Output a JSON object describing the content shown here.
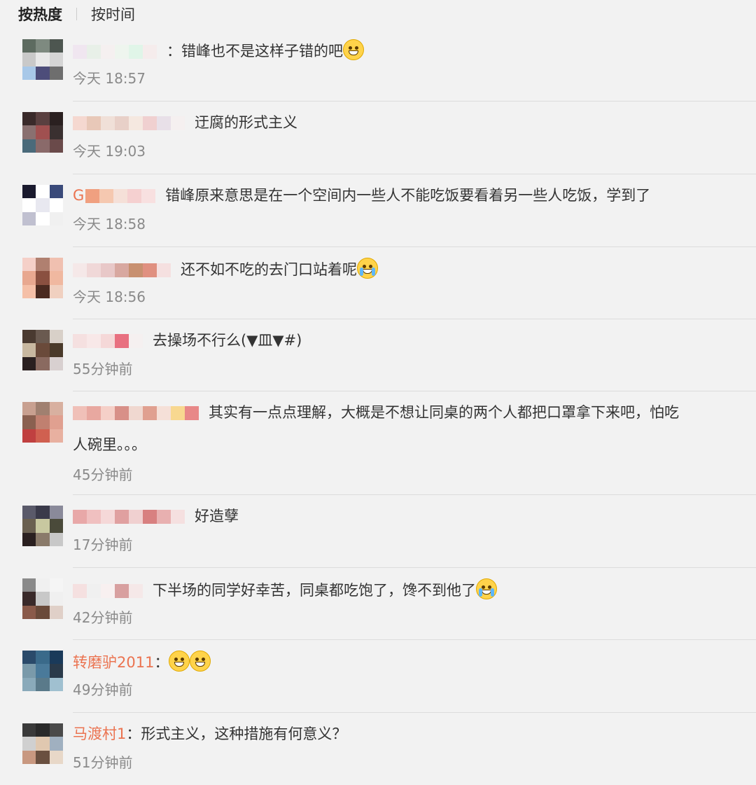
{
  "tabs": {
    "hot": "按热度",
    "time": "按时间"
  },
  "comments": [
    {
      "name": "",
      "text": "：错峰也不是这样子错的吧",
      "time": "今天 18:57",
      "emoji": "sweat-smile-emoji",
      "avatar": [
        "#5d6b60",
        "#7e8a80",
        "#4d5650",
        "#c9c9c9",
        "#e8e8e8",
        "#d5d5d5",
        "#a8c8e8",
        "#4d4d7a",
        "#6e6e6e"
      ],
      "blur": [
        "#f0e6f0",
        "#e8f0e8",
        "#f5f0f0",
        "#eef5ee",
        "#e0f5e8",
        "#f5ecec"
      ]
    },
    {
      "name": "",
      "text": "迂腐的形式主义",
      "time": "今天 19:03",
      "emoji": "",
      "avatar": [
        "#3a2a2a",
        "#5a4040",
        "#2a2020",
        "#8a7070",
        "#a05050",
        "#3a3030",
        "#4a6a7a",
        "#8a6a6a",
        "#6a4a4a"
      ],
      "blur": [
        "#f5d8d0",
        "#e8c8b8",
        "#f0e0d8",
        "#e8d0c8",
        "#f5e8e0",
        "#f0d0d0",
        "#e8e0e8",
        "#f5f0f0"
      ]
    },
    {
      "name": "G",
      "text": "错峰原来意思是在一个空间内一些人不能吃饭要看着另一些人吃饭，学到了",
      "time": "今天 18:58",
      "emoji": "",
      "avatar": [
        "#1a1a2e",
        "#ffffff",
        "#3a4a7a",
        "#ffffff",
        "#e8e8f0",
        "#ffffff",
        "#c0c0d0",
        "#ffffff",
        "#f0f0f0"
      ],
      "blur": [
        "#f0a080",
        "#f5c8b0",
        "#f5e0d8",
        "#f5d0d0",
        "#f8e0e0"
      ]
    },
    {
      "name": "",
      "text": "还不如不吃的去门口站着呢",
      "time": "今天 18:56",
      "emoji": "cry-laugh-emoji",
      "avatar": [
        "#f5d0c8",
        "#b08070",
        "#f0c0b0",
        "#e8a890",
        "#8a5040",
        "#f0b8a0",
        "#f5c0a8",
        "#4a2a20",
        "#f0d0c0"
      ],
      "blur": [
        "#f5e8e8",
        "#f0d8d8",
        "#e8c8c8",
        "#d8a8a0",
        "#c89070",
        "#e09080",
        "#f5e0e0"
      ]
    },
    {
      "name": "",
      "text": "去操场不行么(▼皿▼#)",
      "time": "55分钟前",
      "emoji": "",
      "avatar": [
        "#4a3a30",
        "#6a5a50",
        "#d8d0c8",
        "#c8b8a0",
        "#6a4a3a",
        "#4a3a2a",
        "#2a2020",
        "#8a6a60",
        "#d8d0d0"
      ],
      "blur": [
        "#f5e0e0",
        "#f8e8e8",
        "#f5d8d8",
        "#e87080",
        "#f5f0f0"
      ]
    },
    {
      "name": "",
      "text": "其实有一点点理解，大概是不想让同桌的两个人都把口罩拿下来吧，怕吃",
      "text2": "人碗里。。。",
      "time": "45分钟前",
      "emoji": "",
      "avatar": [
        "#c8a090",
        "#a08070",
        "#d8b0a0",
        "#8a6050",
        "#c08070",
        "#e0a090",
        "#c04040",
        "#d06050",
        "#e8b0a0"
      ],
      "blur": [
        "#f0c0b8",
        "#e8a8a0",
        "#f5d0c8",
        "#d89088",
        "#f0d8d0",
        "#e0a090",
        "#f5e0d8",
        "#f8d890",
        "#e88888"
      ]
    },
    {
      "name": "",
      "text": "好造孽",
      "time": "17分钟前",
      "emoji": "",
      "avatar": [
        "#5a5a6a",
        "#3a3a4a",
        "#8a8a9a",
        "#6a6050",
        "#c8c8a0",
        "#4a4a3a",
        "#2a2020",
        "#8a7a6a",
        "#c8c8c8"
      ],
      "blur": [
        "#e8a8a8",
        "#f0c0c0",
        "#f5d8d8",
        "#e0a0a0",
        "#f0d0d0",
        "#d88080",
        "#e8b0b0",
        "#f5e0e0"
      ]
    },
    {
      "name": "",
      "text": "下半场的同学好幸苦，同桌都吃饱了，馋不到他了",
      "time": "42分钟前",
      "emoji": "cry-emoji",
      "avatar": [
        "#8a8a8a",
        "#f0f0f0",
        "#f5f5f5",
        "#3a2a2a",
        "#c8c8c8",
        "#f0f0f0",
        "#8a5a4a",
        "#6a4a3a",
        "#e0d0c8"
      ],
      "blur": [
        "#f5e0e0",
        "#f0f0f0",
        "#f8f0f0",
        "#d8a0a0",
        "#f5e8e8"
      ]
    },
    {
      "name": "转磨驴2011",
      "text": "：",
      "time": "49分钟前",
      "emoji": "grin-emoji-pair",
      "avatar": [
        "#2a4a6a",
        "#3a6a8a",
        "#1a3a5a",
        "#7a9aaa",
        "#4a7a9a",
        "#2a3a4a",
        "#8aaaba",
        "#5a7a8a",
        "#a0c0d0"
      ],
      "blur": []
    },
    {
      "name": "马渡村1",
      "text": "：形式主义，这种措施有何意义？",
      "time": "51分钟前",
      "emoji": "",
      "avatar": [
        "#3a3a3a",
        "#2a2a2a",
        "#4a4a4a",
        "#d0d0d0",
        "#e0c8b0",
        "#a0b0c0",
        "#c89880",
        "#6a5040",
        "#e8d8c8"
      ],
      "blur": []
    }
  ]
}
